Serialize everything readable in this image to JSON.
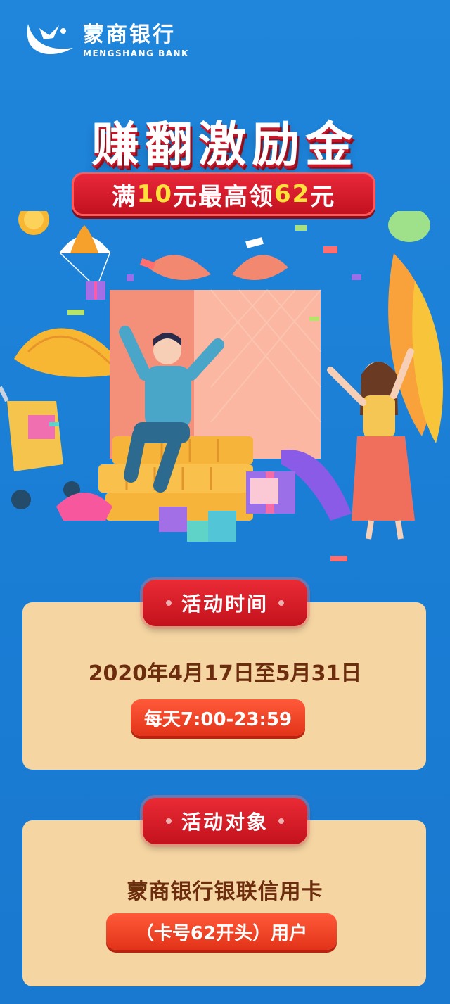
{
  "brand": {
    "name_cn": "蒙商银行",
    "name_en": "MENGSHANG BANK"
  },
  "hero": {
    "title": "赚翻激励金",
    "subtitle_prefix": "满",
    "subtitle_num1": "10",
    "subtitle_mid": "元最高领",
    "subtitle_num2": "62",
    "subtitle_suffix": "元"
  },
  "activity_time": {
    "badge": "活动时间",
    "date_range": "2020年4月17日至5月31日",
    "daily_hours": "每天7:00-23:59"
  },
  "activity_target": {
    "badge": "活动对象",
    "card_type": "蒙商银行银联信用卡",
    "user_note": "（卡号62开头）用户"
  },
  "colors": {
    "background": "#1b7fd6",
    "card": "#f5d5a2",
    "badge_red": "#d81e2b",
    "pill_orange": "#f0461f",
    "text_brown": "#6b2d0e"
  }
}
